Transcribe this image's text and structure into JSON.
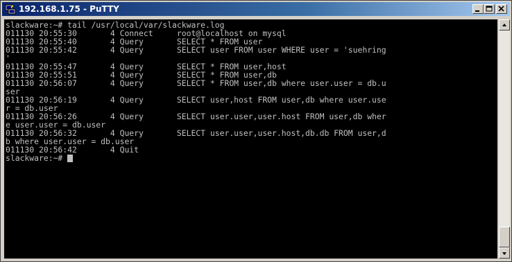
{
  "window": {
    "title": "192.168.1.75 - PuTTY",
    "app_icon": "putty-icon",
    "controls": {
      "minimize": "_",
      "maximize": "□",
      "close": "×"
    }
  },
  "terminal": {
    "lines": [
      "slackware:~# tail /usr/local/var/slackware.log",
      "011130 20:55:30       4 Connect     root@localhost on mysql",
      "011130 20:55:40       4 Query       SELECT * FROM user",
      "011130 20:55:42       4 Query       SELECT user FROM user WHERE user = 'suehring",
      "'",
      "011130 20:55:47       4 Query       SELECT * FROM user,host",
      "011130 20:55:51       4 Query       SELECT * FROM user,db",
      "011130 20:56:07       4 Query       SELECT * FROM user,db where user.user = db.u",
      "ser",
      "011130 20:56:19       4 Query       SELECT user,host FROM user,db where user.use",
      "r = db.user",
      "011130 20:56:26       4 Query       SELECT user.user,user.host FROM user,db wher",
      "e user.user = db.user",
      "011130 20:56:32       4 Query       SELECT user.user,user.host,db.db FROM user,d",
      "b where user.user = db.user",
      "011130 20:56:42       4 Quit",
      "slackware:~# "
    ],
    "colors": {
      "background": "#000000",
      "foreground": "#c0c0c0"
    }
  },
  "scrollbar": {
    "up_icon": "scroll-up-arrow-icon",
    "down_icon": "scroll-down-arrow-icon",
    "position": 1.0
  }
}
